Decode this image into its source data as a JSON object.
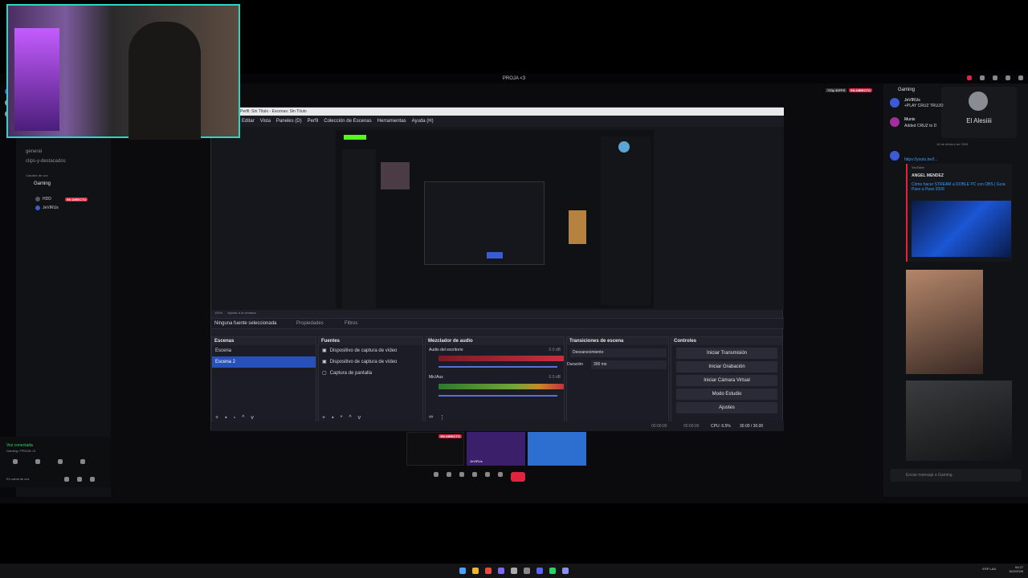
{
  "topbar": {
    "title": "PROJA <3"
  },
  "stream_badges": {
    "quality": "720p 30FPS",
    "live": "EN DIRECTO"
  },
  "discord": {
    "channels": [
      "general",
      "clips-y-destacados"
    ],
    "voice_section": "Canales de voz",
    "voice_channel": "Gaming",
    "voice_users": [
      {
        "name": "HDD",
        "badge": ""
      },
      {
        "name": "JeVIRUs",
        "badge": ""
      }
    ],
    "live_badge": "EN DIRECTO",
    "voice_status": "Voz conectada",
    "voice_sub": "Gaming / PROJA <3",
    "user_status": "En canal de voz"
  },
  "obs": {
    "title": "Perfil: Sin Título - Escenas: Sin Título",
    "menu": [
      "Editar",
      "Vista",
      "Paneles (D)",
      "Perfil",
      "Colección de Escenas",
      "Herramientas",
      "Ayuda (H)"
    ],
    "zoom": "100%",
    "fit_label": "Ajustar a la ventana",
    "no_source": "Ninguna fuente seleccionada",
    "properties": "Propiedades",
    "filters": "Filtros",
    "docks": {
      "scenes": {
        "title": "Escenas",
        "items": [
          "Escena",
          "Escena 2"
        ],
        "selected": 1
      },
      "sources": {
        "title": "Fuentes",
        "items": [
          "Dispositivo de captura de vídeo",
          "Dispositivo de captura de vídeo",
          "Captura de pantalla"
        ]
      },
      "mixer": {
        "title": "Mezclador de audio",
        "channels": [
          {
            "name": "Audio del escritorio",
            "db": "0.0 dB"
          },
          {
            "name": "Mic/Aux",
            "db": "0.0 dB"
          }
        ]
      },
      "transitions": {
        "title": "Transiciones de escena",
        "type": "Desvanecimiento",
        "duration_label": "Duración",
        "duration": "300 ms"
      },
      "controls": {
        "title": "Controles",
        "buttons": [
          "Iniciar Transmisión",
          "Iniciar Grabación",
          "Iniciar Cámara Virtual",
          "Modo Estudio",
          "Ajustes"
        ]
      }
    },
    "status": {
      "time1": "00:00:00",
      "time2": "00:00:00",
      "cpu": "CPU: 6.5%",
      "fps": "30.00 / 30.00"
    }
  },
  "call": {
    "tiles": [
      {
        "label": "",
        "live": "EN DIRECTO"
      },
      {
        "label": "JeVIRUs"
      },
      {
        "label": ""
      }
    ]
  },
  "chat": {
    "channel": "Gaming",
    "profile_name": "El Alesiiii",
    "messages": [
      {
        "author": "JeVIRUs",
        "text": "+PLAY CRUZ TRUJO"
      },
      {
        "author": "Munix",
        "text": "Added CRUZ to D"
      },
      {
        "author": "",
        "text": "https://youtu.be/f..."
      }
    ],
    "date_divider": "16 de febrero de 2026",
    "embed": {
      "provider": "YouTube",
      "author": "ANGEL MENDEZ",
      "title": "Cómo hacer STREAM a DOBLE PC con OBS | Guía Paso a Paso 2026"
    },
    "input_placeholder": "Enviar mensaje a Gaming"
  },
  "taskbar": {
    "lang": "ESP LAA",
    "time": "04:27",
    "date": "16/2/2026"
  },
  "colors": {
    "accent": "#2750b8",
    "live": "#e0233e",
    "obs_bg": "#1e1f29",
    "cam_border": "#2ad6c4"
  }
}
